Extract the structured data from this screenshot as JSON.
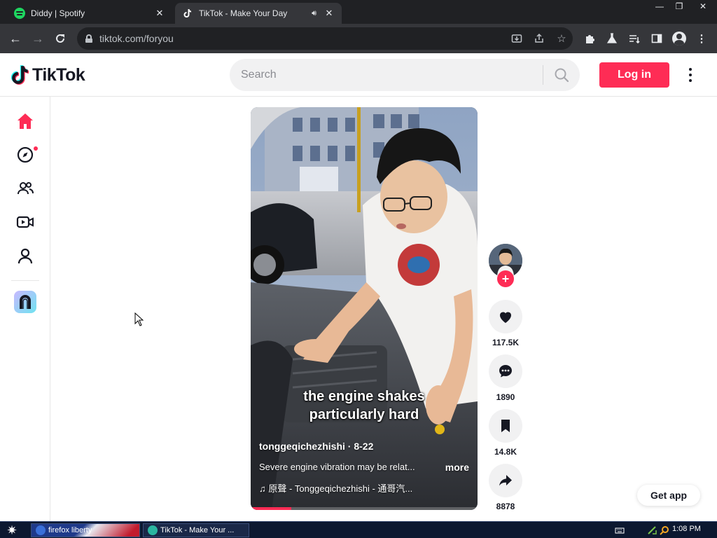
{
  "browser": {
    "tabs": [
      {
        "title": "Diddy | Spotify",
        "active": false,
        "icon": "spotify-icon"
      },
      {
        "title": "TikTok - Make Your Day",
        "active": true,
        "icon": "tiktok-icon",
        "audio": true
      }
    ],
    "url": "tiktok.com/foryou",
    "window_controls": {
      "minimize": "—",
      "restore": "❐",
      "close": "✕"
    }
  },
  "header": {
    "logo_text": "TikTok",
    "search_placeholder": "Search",
    "login_label": "Log in"
  },
  "sidebar": {
    "items": [
      {
        "icon": "home-icon",
        "active": true
      },
      {
        "icon": "explore-icon",
        "notification": true
      },
      {
        "icon": "following-icon"
      },
      {
        "icon": "live-icon"
      },
      {
        "icon": "profile-icon"
      },
      {
        "icon": "effect-house-icon"
      }
    ]
  },
  "video": {
    "caption_line1": "the engine shakes",
    "caption_line2": "particularly hard",
    "author": "tonggeqichezhishi",
    "date": "8-22",
    "description": "Severe engine vibration may be relat...",
    "more_label": "more",
    "music": "♫ 原聲 - Tonggeqichezhishi - 通哥汽...",
    "progress": 0.18
  },
  "actions": {
    "likes": "117.5K",
    "comments": "1890",
    "saves": "14.8K",
    "shares": "8878"
  },
  "get_app_label": "Get app",
  "taskbar": {
    "items": [
      {
        "label": "firefox liberty"
      },
      {
        "label": "TikTok - Make Your ..."
      }
    ],
    "clock": "1:08 PM"
  },
  "colors": {
    "brand": "#fe2c55",
    "browser_dark": "#202124",
    "toolbar": "#35363a"
  }
}
